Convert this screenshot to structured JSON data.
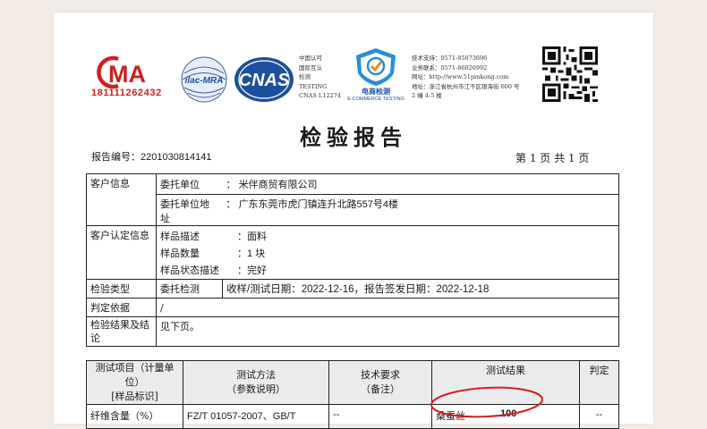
{
  "logos": {
    "ma_text": "MA",
    "ma_number": "181111262432",
    "ilac_text": "ilac-MRA",
    "cnas_text": "CNAS",
    "cnas_info": [
      "中国认可",
      "国际互认",
      "检测",
      "TESTING",
      "CNAS L12274"
    ],
    "shield_caption_cn": "电商检测",
    "shield_caption_en": "E-COMMERCE TESTING"
  },
  "contact": [
    "技术支持：0571-85073696",
    "业务联系：0571-86026992",
    "网址：http://www.51pinkong.com",
    "地址：浙江省杭州市江干区银海街 600 号",
    "2 幢 4-5 楼"
  ],
  "title": "检验报告",
  "report_no_label": "报告编号：",
  "report_no": "2201030814141",
  "page_info": "第 1 页 共 1 页",
  "client": {
    "section": "客户信息",
    "unit_label": "委托单位",
    "unit_value": "米伴商贸有限公司",
    "address_label": "委托单位地址",
    "address_value": "广东东莞市虎门镇连升北路557号4楼"
  },
  "sample": {
    "section": "客户认定信息",
    "desc_label": "样品描述",
    "desc_value": "面料",
    "qty_label": "样品数量",
    "qty_value": "1 块",
    "state_label": "样品状态描述",
    "state_value": "完好"
  },
  "inspection": {
    "type_label": "检验类型",
    "type_value": "委托检测",
    "dates": "收样/测试日期：2022-12-16，报告签发日期：2022-12-18",
    "basis_label": "判定依据",
    "basis_value": "/",
    "conclusion_label_1": "检验结果及结",
    "conclusion_label_2": "论",
    "conclusion_value": "见下页。"
  },
  "results": {
    "headers": {
      "item": "测试项目（计量单位）",
      "item_sub": "[样品标识]",
      "method": "测试方法",
      "method_sub": "（参数说明）",
      "req": "技术要求",
      "req_sub": "（备注）",
      "result": "测试结果",
      "verdict": "判定"
    },
    "row": {
      "item": "纤维含量（%）",
      "method": "FZ/T 01057-2007、GB/T",
      "req": "--",
      "result_name": "桑蚕丝",
      "result_value": "100",
      "verdict": "--"
    }
  },
  "colors": {
    "brand_red": "#d0201c",
    "cnas_blue": "#1e4f9c",
    "annotation_red": "#d42020"
  }
}
